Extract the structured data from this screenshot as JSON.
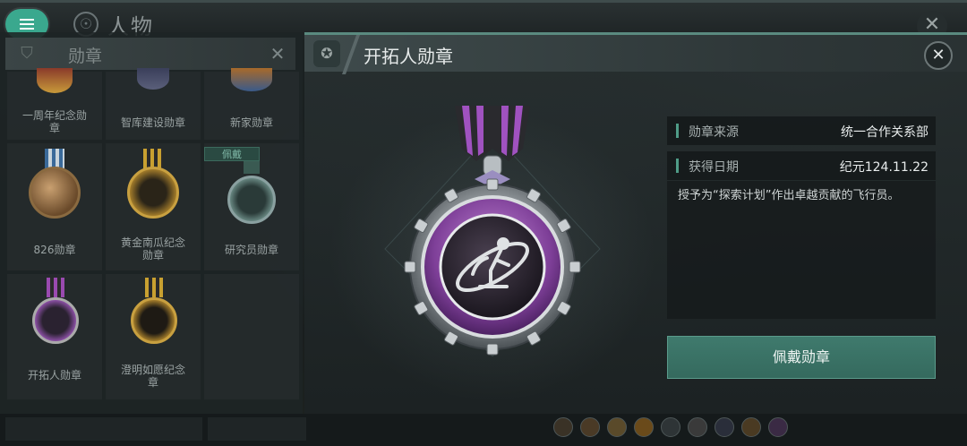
{
  "topbar": {
    "title": "人物"
  },
  "left_panel": {
    "title": "勋章",
    "wear_tag": "佩戴",
    "medals": [
      {
        "name": "一周年纪念勋章",
        "line1": "一周年纪念勋",
        "line2": "章"
      },
      {
        "name": "智库建设勋章",
        "line1": "智库建设勋章",
        "line2": ""
      },
      {
        "name": "新家勋章",
        "line1": "新家勋章",
        "line2": ""
      },
      {
        "name": "826勋章",
        "line1": "826勋章",
        "line2": ""
      },
      {
        "name": "黄金南瓜纪念勋章",
        "line1": "黄金南瓜纪念",
        "line2": "勋章"
      },
      {
        "name": "研究员勋章",
        "line1": "研究员勋章",
        "line2": ""
      },
      {
        "name": "开拓人勋章",
        "line1": "开拓人勋章",
        "line2": ""
      },
      {
        "name": "澄明如愿纪念章",
        "line1": "澄明如愿纪念",
        "line2": "章"
      }
    ]
  },
  "detail": {
    "title": "开拓人勋章",
    "source_label": "勋章来源",
    "source_value": "统一合作关系部",
    "date_label": "获得日期",
    "date_value": "纪元124.11.22",
    "description": "授予为“探索计划”作出卓越贡献的飞行员。",
    "wear_button": "佩戴勋章"
  },
  "colors": {
    "accent": "#3aa88e",
    "medal_purple": "#8a4fa3",
    "button": "#3f7a6d"
  }
}
